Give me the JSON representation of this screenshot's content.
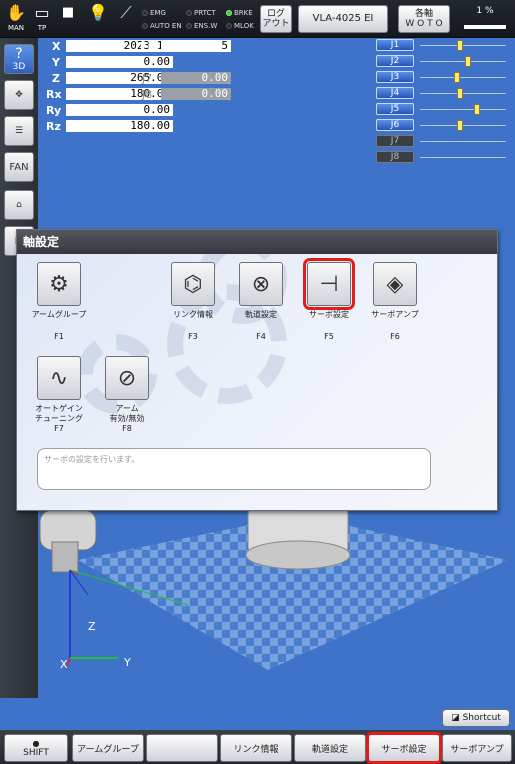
{
  "topbar": {
    "man_label": "MAN",
    "tp_label": "TP",
    "indicators": [
      {
        "label": "EMG",
        "on": false
      },
      {
        "label": "AUTO EN",
        "on": false
      },
      {
        "label": "PRTCT",
        "on": false
      },
      {
        "label": "ENS.W",
        "on": false
      },
      {
        "label": "BRKE",
        "on": true
      },
      {
        "label": "MLOK",
        "on": false
      }
    ],
    "log_button": "ログ\nアウト",
    "model": "VLA-4025 EI",
    "jog_mode_line1": "各軸",
    "jog_mode_line2": "W O T O",
    "speed": "1 %"
  },
  "left_toolbar": {
    "view3d": "3D",
    "fan": "FAN"
  },
  "coords": {
    "X": "2023.16",
    "Y": "0.00",
    "Z": "265.04",
    "Rx": "180.00",
    "Ry": "0.00",
    "Rz": "180.00",
    "fig_label": "Fig",
    "fig": "5",
    "j7_label": "J7",
    "j7": "0.00",
    "j8_label": "J8",
    "j8": "0.00"
  },
  "joints": [
    {
      "name": "J1",
      "active": true,
      "pos": 0.45
    },
    {
      "name": "J2",
      "active": true,
      "pos": 0.55
    },
    {
      "name": "J3",
      "active": true,
      "pos": 0.42
    },
    {
      "name": "J4",
      "active": true,
      "pos": 0.45
    },
    {
      "name": "J5",
      "active": true,
      "pos": 0.66
    },
    {
      "name": "J6",
      "active": true,
      "pos": 0.45
    },
    {
      "name": "J7",
      "active": false,
      "pos": null
    },
    {
      "name": "J8",
      "active": false,
      "pos": null
    }
  ],
  "dialog": {
    "title": "軸設定",
    "items": [
      {
        "label": "アームグループ",
        "key": "F1",
        "icon": "arm-group-icon",
        "glyph": "⚙"
      },
      {
        "label": "リンク情報",
        "key": "F3",
        "icon": "link-info-icon",
        "glyph": "⌬"
      },
      {
        "label": "軌道設定",
        "key": "F4",
        "icon": "trajectory-icon",
        "glyph": "⊗"
      },
      {
        "label": "サーボ設定",
        "key": "F5",
        "icon": "servo-settings-icon",
        "glyph": "⊣"
      },
      {
        "label": "サーボアンプ",
        "key": "F6",
        "icon": "servo-amp-icon",
        "glyph": "◈"
      },
      {
        "label": "オートゲイン\nチューニング",
        "key": "F7",
        "icon": "auto-gain-icon",
        "glyph": "∿"
      },
      {
        "label": "アーム\n有効/無効",
        "key": "F8",
        "icon": "arm-enable-icon",
        "glyph": "⊘"
      }
    ],
    "description": "サーボの設定を行います。"
  },
  "axes": {
    "z": "Z",
    "x": "X",
    "y": "Y"
  },
  "shortcut": "Shortcut",
  "bottom": {
    "shift": "SHIFT",
    "f1": "アームグループ",
    "f2": "",
    "f3": "リンク情報",
    "f4": "軌道設定",
    "f5": "サーボ設定",
    "f6": "サーボアンプ"
  }
}
